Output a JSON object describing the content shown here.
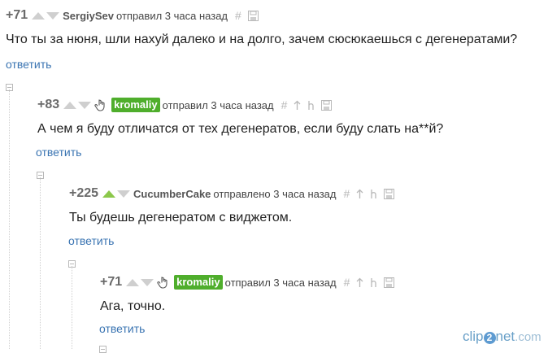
{
  "comments": [
    {
      "rating": "+71",
      "author": "SergiySev",
      "meta": "отправил 3 часа назад",
      "text": "Что ты за нюня, шли нахуй далеко и на долго, зачем сюсюкаешься с дегенератами?",
      "reply": "ответить"
    },
    {
      "rating": "+83",
      "author": "kromaliy",
      "meta": "отправил 3 часа назад",
      "text": "А чем я буду отличатся от тех дегенератов, если буду слать на**й?",
      "reply": "ответить"
    },
    {
      "rating": "+225",
      "author": "CucumberCake",
      "meta": "отправлено 3 часа назад",
      "text": "Ты будешь дегенератом с виджетом.",
      "reply": "ответить"
    },
    {
      "rating": "+71",
      "author": "kromaliy",
      "meta": "отправил 3 часа назад",
      "text": "Ага, точно.",
      "reply": "ответить"
    }
  ],
  "icons": {
    "permalink": "#",
    "to_parent": "↑",
    "to_root": "⊥"
  },
  "watermark": {
    "part1": "clip",
    "part2": "2",
    "part3": "net",
    "part4": ".com"
  },
  "colors": {
    "badge": "#4fae2c",
    "reply_link": "#3a74b2",
    "upvote_active": "#8cc84b"
  }
}
